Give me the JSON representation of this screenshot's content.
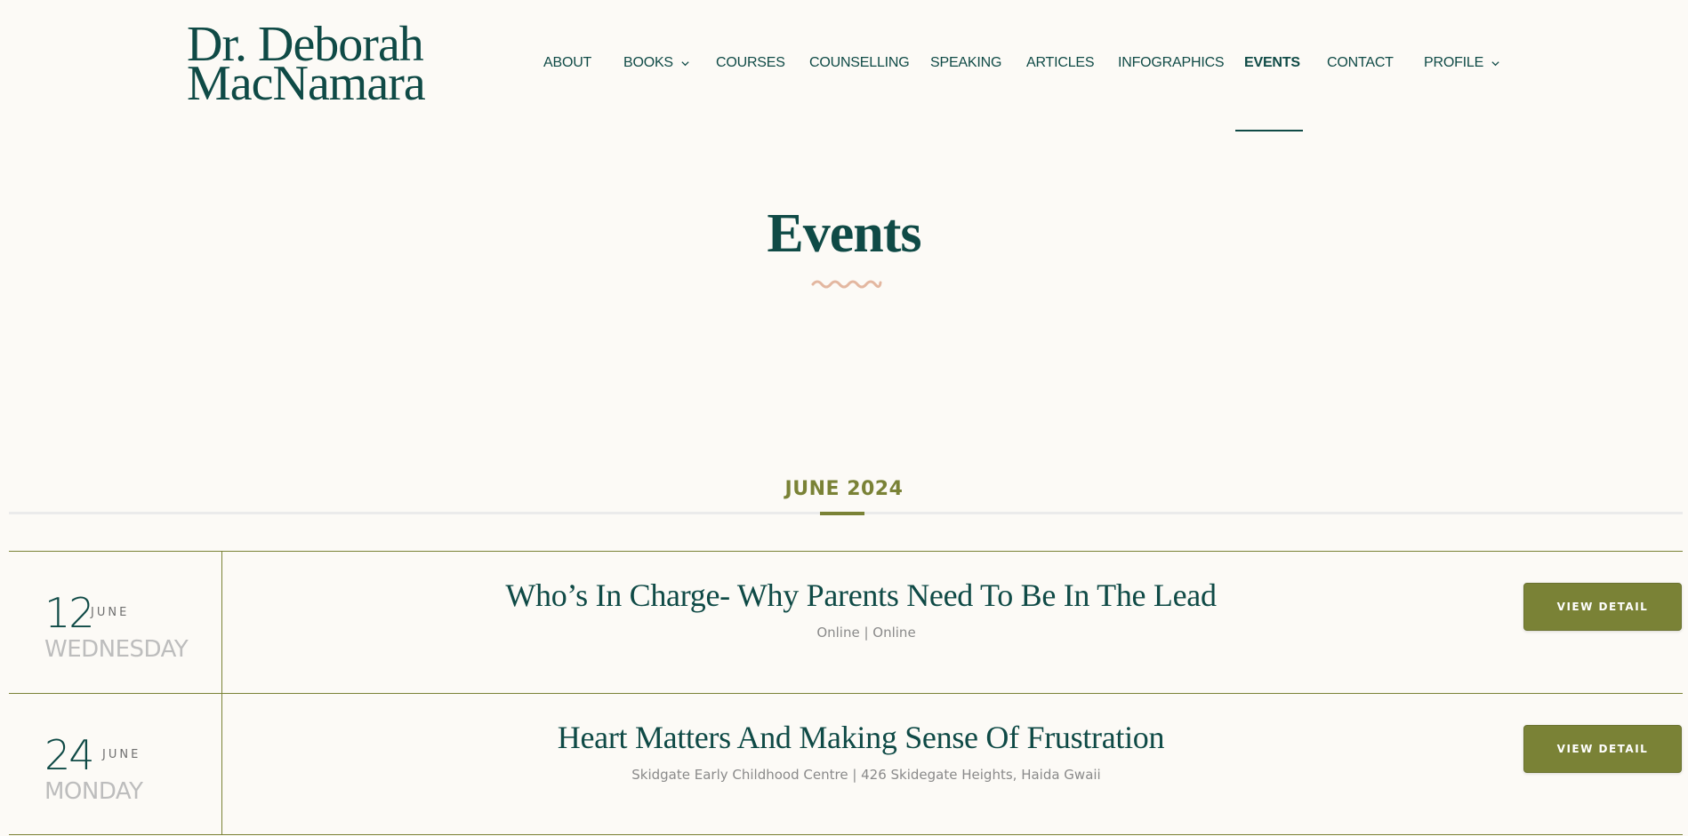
{
  "logo": {
    "line1": "Dr. Deborah",
    "line2": "MacNamara"
  },
  "nav": {
    "items": [
      {
        "label": "ABOUT"
      },
      {
        "label": "BOOKS",
        "icon": "chevron-down-icon"
      },
      {
        "label": "COURSES"
      },
      {
        "label": "COUNSELLING"
      },
      {
        "label": "SPEAKING"
      },
      {
        "label": "ARTICLES"
      },
      {
        "label": "INFOGRAPHICS"
      },
      {
        "label": "EVENTS",
        "active": true
      },
      {
        "label": "CONTACT"
      },
      {
        "label": "PROFILE",
        "icon": "chevron-down-icon"
      }
    ]
  },
  "hero": {
    "title": "Events",
    "decoration": "squiggle-divider-icon"
  },
  "month_header": "JUNE 2024",
  "events": [
    {
      "day": "12",
      "month": "JUNE",
      "weekday": "WEDNESDAY",
      "title": "Who’s In Charge- Why Parents Need To Be In The Lead",
      "location": "Online | Online",
      "button_label": "VIEW DETAIL"
    },
    {
      "day": "24",
      "month": "JUNE",
      "weekday": "MONDAY",
      "title": "Heart Matters And Making Sense Of Frustration",
      "location": "Skidgate Early Childhood Centre | 426 Skidegate Heights, Haida Gwaii",
      "button_label": "VIEW DETAIL"
    }
  ],
  "colors": {
    "background": "#fcfaf6",
    "primary": "#0f4a46",
    "accent": "#7a8236",
    "squiggle": "#e3b7a0",
    "muted": "#bdbdbd"
  }
}
